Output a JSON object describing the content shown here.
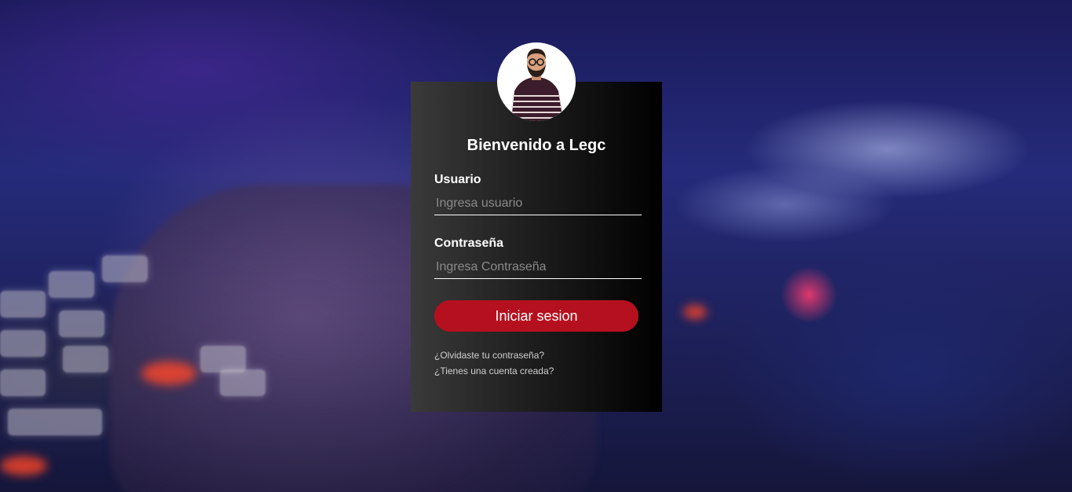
{
  "login": {
    "title": "Bienvenido a Legc",
    "username_label": "Usuario",
    "username_placeholder": "Ingresa usuario",
    "username_value": "",
    "password_label": "Contraseña",
    "password_placeholder": "Ingresa Contraseña",
    "password_value": "",
    "submit_label": "Iniciar sesion",
    "forgot_password_link": "¿Olvidaste tu contraseña?",
    "have_account_link": "¿Tienes una cuenta creada?"
  },
  "icons": {
    "avatar": "user-avatar-illustration"
  },
  "colors": {
    "accent": "#b5101f",
    "card_start": "#3a3a3a",
    "card_end": "#000000",
    "text": "#ffffff"
  }
}
